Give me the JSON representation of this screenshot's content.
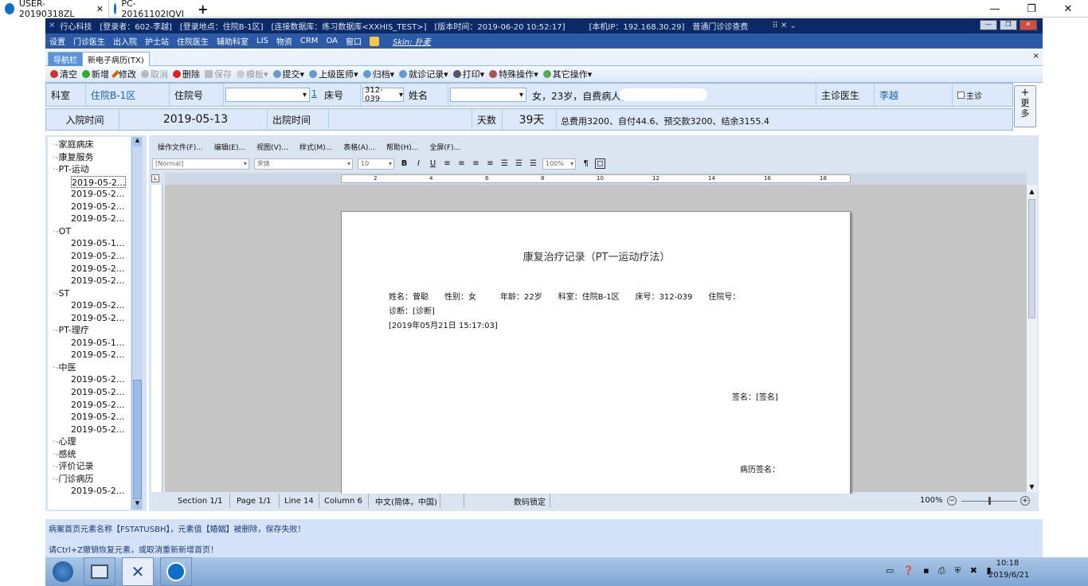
{
  "remote_tabs": [
    {
      "label": "USER-20190318ZL",
      "close": "✕"
    },
    {
      "label": "PC-20161102IQVI"
    }
  ],
  "new_tab_label": "+",
  "window_controls": {
    "minimize": "—",
    "restore": "❐",
    "close": "✕"
  },
  "app": {
    "title": "行心科技　[登录者：602-李越]　[登录地点：住院B-1区]　[连接数据库：练习数据库<XXHIS_TEST>]　[版本时间：2019-06-20 10:52:17]　　　[本机IP：192.168.30.29]　普通门诊诊查费",
    "menu": [
      "设置",
      "门诊医生",
      "出入院",
      "护士站",
      "住院医生",
      "辅助科室",
      "LIS",
      "物资",
      "CRM",
      "OA",
      "窗口"
    ],
    "skin_label": "Skin: 扑麦",
    "doc_tabs": [
      "导航栏",
      "新电子病历(TX)"
    ],
    "doc_tab_close": "×"
  },
  "toolbar": [
    {
      "label": "清空",
      "icon": "broom-icon",
      "enabled": true
    },
    {
      "label": "新增",
      "icon": "plus-icon",
      "enabled": true
    },
    {
      "label": "修改",
      "icon": "pencil-icon",
      "enabled": true
    },
    {
      "label": "取消",
      "icon": "cancel-icon",
      "enabled": false
    },
    {
      "label": "删除",
      "icon": "delete-icon",
      "enabled": true
    },
    {
      "label": "保存",
      "icon": "save-icon",
      "enabled": false
    },
    {
      "label": "模板",
      "icon": "template-icon",
      "enabled": false
    },
    {
      "label": "提交",
      "icon": "submit-icon",
      "enabled": true
    },
    {
      "label": "上级医师",
      "icon": "doctor-icon",
      "enabled": true
    },
    {
      "label": "归档",
      "icon": "archive-icon",
      "enabled": true
    },
    {
      "label": "就诊记录",
      "icon": "record-icon",
      "enabled": true
    },
    {
      "label": "打印",
      "icon": "print-icon",
      "enabled": true
    },
    {
      "label": "特殊操作",
      "icon": "special-icon",
      "enabled": true
    },
    {
      "label": "其它操作",
      "icon": "other-icon",
      "enabled": true
    }
  ],
  "patient": {
    "dept_label": "科室",
    "dept_value": "住院B-1区",
    "inpatient_no_label": "住院号",
    "inpatient_no_link": "1",
    "bed_label": "床号",
    "bed_value": "312-039",
    "name_label": "姓名",
    "name_info": "女，23岁，自费病人，",
    "doctor_label": "主诊医生",
    "doctor_value": "李越",
    "main_checkbox_label": "主诊",
    "admit_label": "入院时间",
    "admit_value": "2019-05-13",
    "discharge_label": "出院时间",
    "days_label": "天数",
    "days_value": "39天",
    "fee_summary": "总费用3200、自付44.6、预交款3200、结余3155.4",
    "more_button": "更多"
  },
  "tree": [
    {
      "label": "家庭病床",
      "level": 0
    },
    {
      "label": "康复服务",
      "level": 0
    },
    {
      "label": "PT-运动",
      "level": 0
    },
    {
      "label": "2019-05-2...",
      "level": 1,
      "selected": true
    },
    {
      "label": "2019-05-2...",
      "level": 1
    },
    {
      "label": "2019-05-2...",
      "level": 1
    },
    {
      "label": "2019-05-2...",
      "level": 1
    },
    {
      "label": "OT",
      "level": 0
    },
    {
      "label": "2019-05-1...",
      "level": 1
    },
    {
      "label": "2019-05-2...",
      "level": 1
    },
    {
      "label": "2019-05-2...",
      "level": 1
    },
    {
      "label": "2019-05-2...",
      "level": 1
    },
    {
      "label": "ST",
      "level": 0
    },
    {
      "label": "2019-05-2...",
      "level": 1
    },
    {
      "label": "2019-05-2...",
      "level": 1
    },
    {
      "label": "PT-理疗",
      "level": 0
    },
    {
      "label": "2019-05-1...",
      "level": 1
    },
    {
      "label": "2019-05-2...",
      "level": 1
    },
    {
      "label": "中医",
      "level": 0
    },
    {
      "label": "2019-05-2...",
      "level": 1
    },
    {
      "label": "2019-05-2...",
      "level": 1
    },
    {
      "label": "2019-05-2...",
      "level": 1
    },
    {
      "label": "2019-05-2...",
      "level": 1
    },
    {
      "label": "2019-05-2...",
      "level": 1
    },
    {
      "label": "心理",
      "level": 0
    },
    {
      "label": "感统",
      "level": 0
    },
    {
      "label": "评价记录",
      "level": 0
    },
    {
      "label": "门诊病历",
      "level": 0
    },
    {
      "label": "2019-05-2...",
      "level": 1
    }
  ],
  "editor": {
    "menu": [
      "操作文件(F)...",
      "编辑(E)...",
      "视图(V)...",
      "样式(M)...",
      "表格(A)...",
      "帮助(H)...",
      "全屏(F)..."
    ],
    "style_value": "[Normal]",
    "font_value": "宋体",
    "size_value": "10",
    "zoom_value": "100%",
    "ruler_numbers": [
      "2",
      "4",
      "6",
      "8",
      "10",
      "12",
      "14",
      "16",
      "18"
    ]
  },
  "document": {
    "title": "康复治疗记录（PT一运动疗法）",
    "fields_line": "姓名：曾聪　　性别：女　　　年龄：22岁　　科室：住院B-1区　　床号：312-039　　住院号：",
    "diagnosis": "诊断：[诊断]",
    "datetime": "[2019年05月21日 15:17:03]",
    "signature": "签名：[签名]",
    "record_signature": "病历签名："
  },
  "status": {
    "section": "Section 1/1",
    "page": "Page 1/1",
    "line": "Line 14",
    "column": "Column 6",
    "lang": "中文(简体，中国)",
    "numlock": "数码锁定",
    "zoom": "100%"
  },
  "messages": [
    "病案首页元素名称【FSTATUSBH】，元素值【婚姻】被删除，保存失败！",
    "请Ctrl+Z撤销恢复元素，或取消重新新增首页！"
  ],
  "taskbar": {
    "time": "10:18",
    "date": "2019/6/21"
  }
}
